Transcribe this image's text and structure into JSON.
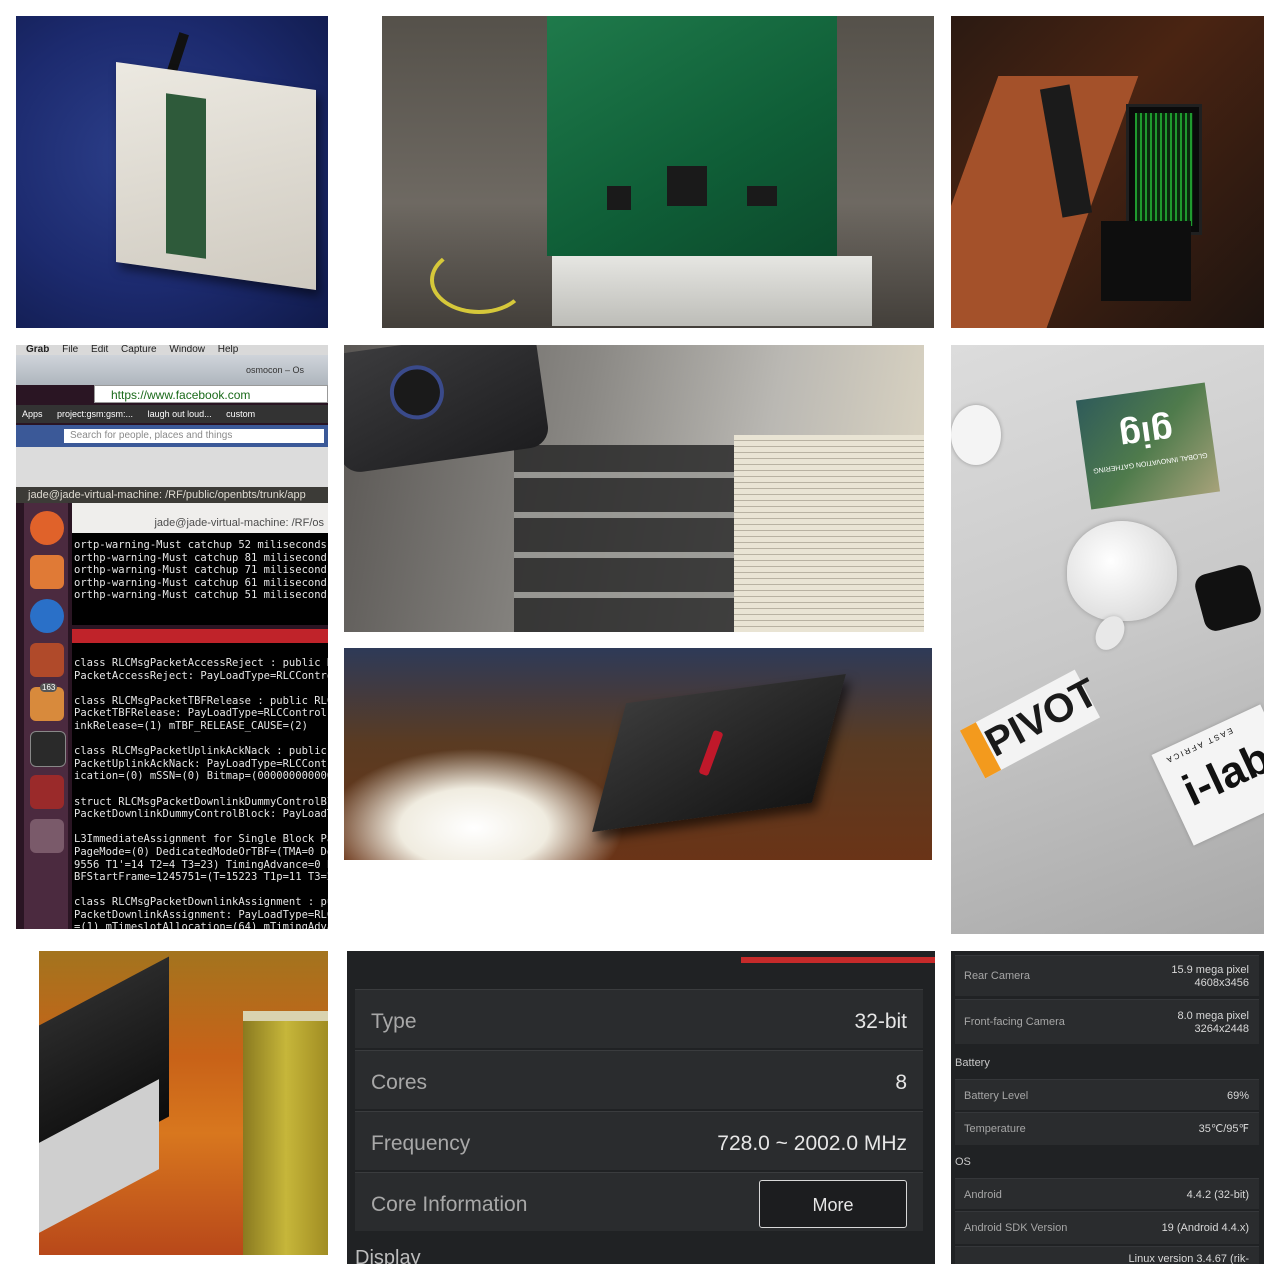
{
  "screenshot_tile": {
    "menubar": [
      "Grab",
      "File",
      "Edit",
      "Capture",
      "Window",
      "Help"
    ],
    "tab_label": "osmocon – Os",
    "url": "https://www.facebook.com",
    "bookmarks": [
      "Apps",
      "project:gsm:gsm:...",
      "laugh out loud...",
      "custom"
    ],
    "fb_search_placeholder": "Search for people, places and things",
    "vm_title": "jade@jade-virtual-machine: /RF/public/openbts/trunk/app",
    "term1_title": "jade@jade-virtual-machine: /RF/os",
    "term1_lines": "ortp-warning-Must catchup 52 miliseconds.\northp-warning-Must catchup 81 miliseconds.\northp-warning-Must catchup 71 miliseconds.\northp-warning-Must catchup 61 miliseconds.\northp-warning-Must catchup 51 miliseconds.",
    "term2_lines": "class RLCMsgPacketAccessReject : public RLC\nPacketAccessReject: PayLoadType=RLCControl\n\nclass RLCMsgPacketTBFRelease : public RLCDo\nPacketTBFRelease: PayLoadType=RLCControl mR\ninkRelease=(1) mTBF_RELEASE_CAUSE=(2)\n\nclass RLCMsgPacketUplinkAckNack : public RL\nPacketUplinkAckNack: PayLoadType=RLCControl\nication=(0) mSSN=(0) Bitmap=(00000000000000\n\nstruct RLCMsgPacketDownlinkDummyControlBloc\nPacketDownlinkDummyControlBlock: PayLoadTyp\n\nL3ImmediateAssignment for Single Block Pack\nPageMode=(0) DedicatedModeOrTBF=(TMA=0 Down\n9556 T1'=14 T2=4 T3=23) TimingAdvance=0 Pac\nBFStartFrame=1245751=(T=15223 T1p=11 T3=25\n\nclass RLCMsgPacketDownlinkAssignment : publ\nPacketDownlinkAssignment: PayLoadType=RLCCo\n=(1) mTimeslotAllocation=(64) mTimingAdvanc",
    "launcher_badge": "163"
  },
  "stickers": {
    "gig": "gig",
    "gig_sub": "GLOBAL INNOVATION GATHERING",
    "pivot": "PIVOT",
    "ilab": "i-lab",
    "ilab_sub": "EAST AFRICA"
  },
  "cpu_info": {
    "rows": [
      {
        "label": "Type",
        "value": "32-bit"
      },
      {
        "label": "Cores",
        "value": "8"
      },
      {
        "label": "Frequency",
        "value": "728.0 ~ 2002.0 MHz"
      },
      {
        "label": "Core Information",
        "value": ""
      }
    ],
    "more_button": "More",
    "next_section": "Display"
  },
  "device_info": {
    "rear_camera_label": "Rear Camera",
    "rear_camera_value_1": "15.9 mega pixel",
    "rear_camera_value_2": "4608x3456",
    "front_camera_label": "Front-facing Camera",
    "front_camera_value_1": "8.0 mega pixel",
    "front_camera_value_2": "3264x2448",
    "battery_section": "Battery",
    "battery_level_label": "Battery Level",
    "battery_level_value": "69%",
    "temperature_label": "Temperature",
    "temperature_value": "35℃/95℉",
    "os_section": "OS",
    "android_label": "Android",
    "android_value": "4.4.2 (32-bit)",
    "sdk_label": "Android SDK Version",
    "sdk_value": "19  (Android 4.4.x)",
    "kernel_value": "Linux version 3.4.67 (rik-"
  }
}
